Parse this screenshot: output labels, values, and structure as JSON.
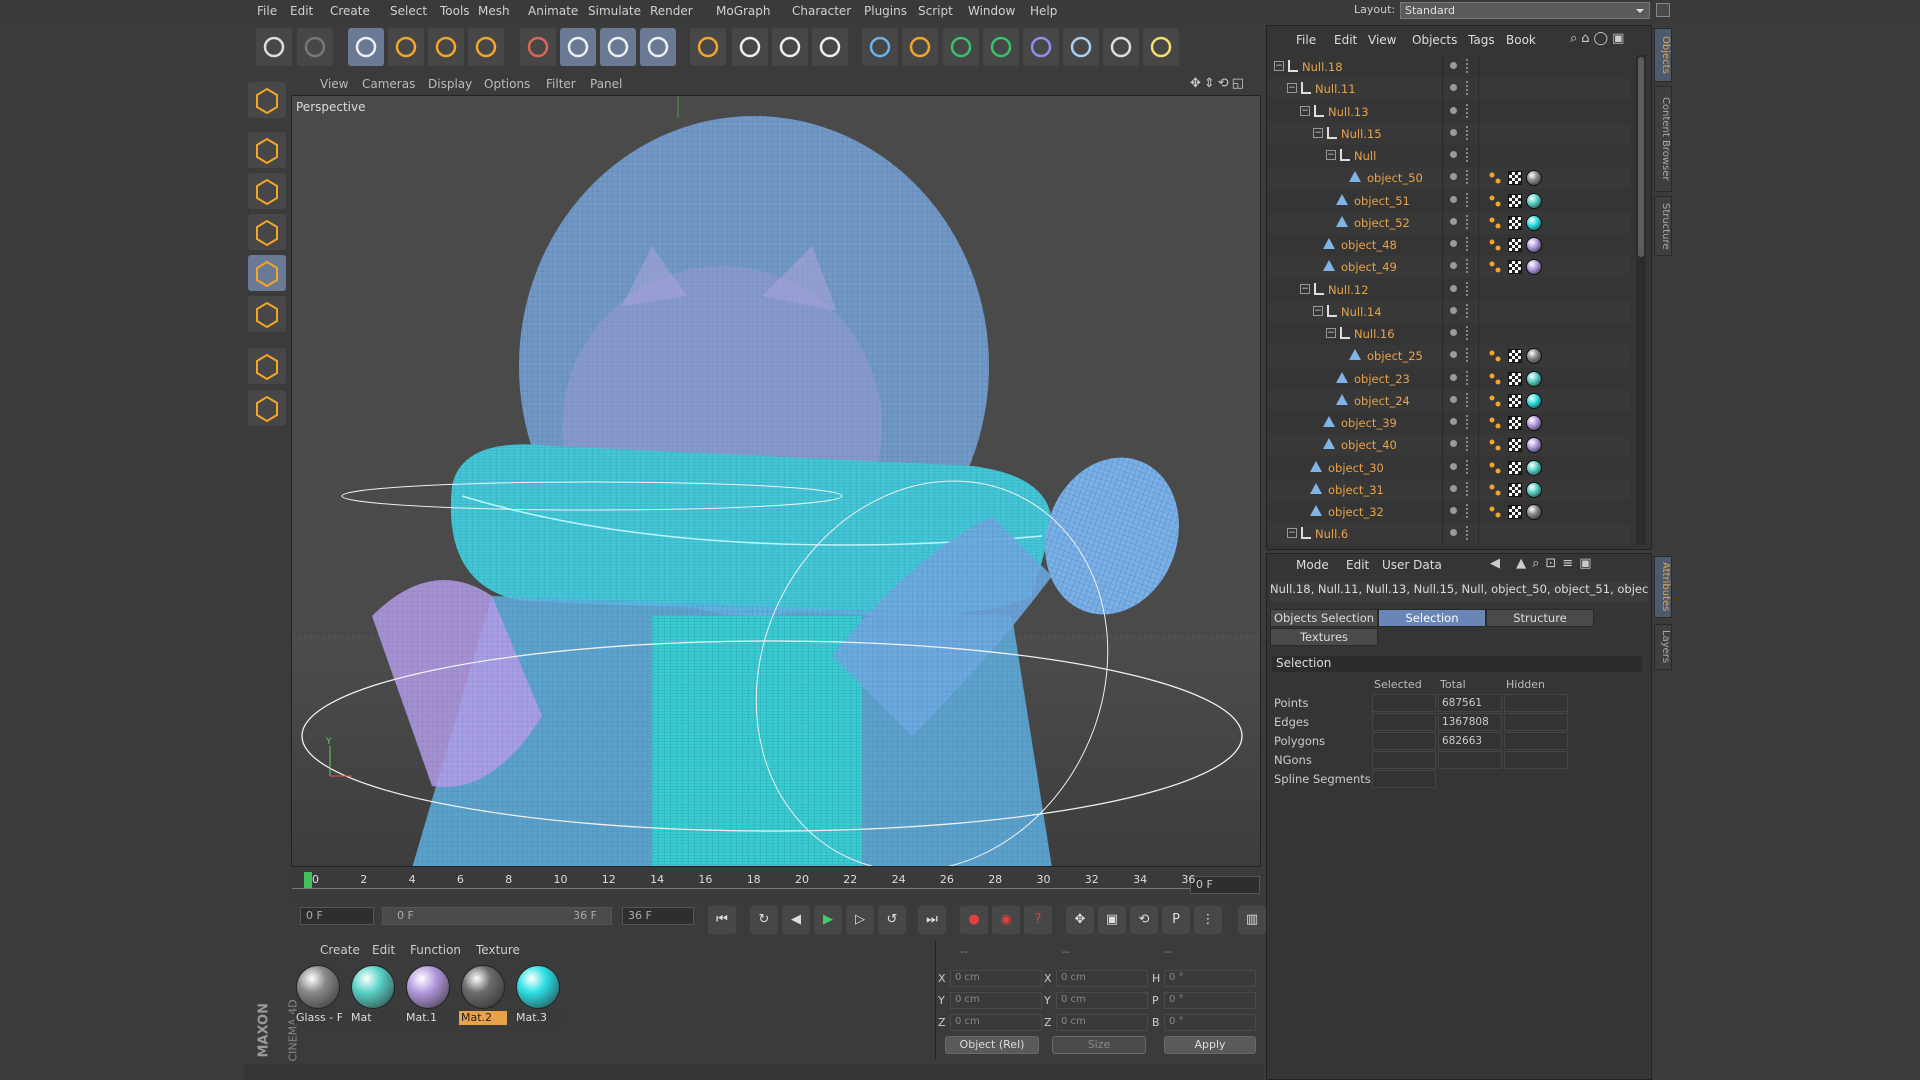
{
  "menubar": {
    "items": [
      "File",
      "Edit",
      "Create",
      "Select",
      "Tools",
      "Mesh",
      "Animate",
      "Simulate",
      "Render",
      "MoGraph",
      "Character",
      "Plugins",
      "Script",
      "Window",
      "Help"
    ],
    "layout_label": "Layout:",
    "layout_value": "Standard"
  },
  "viewport": {
    "menu": [
      "View",
      "Cameras",
      "Display",
      "Options",
      "Filter",
      "Panel"
    ],
    "label": "Perspective"
  },
  "timeline": {
    "ticks": [
      "0",
      "2",
      "4",
      "6",
      "8",
      "10",
      "12",
      "14",
      "16",
      "18",
      "20",
      "22",
      "24",
      "26",
      "28",
      "30",
      "32",
      "34",
      "36"
    ],
    "current_frame": "0 F",
    "start_field": "0 F",
    "range_start": "0 F",
    "range_end": "36 F",
    "end_field": "36 F"
  },
  "materials": {
    "menu": [
      "Create",
      "Edit",
      "Function",
      "Texture"
    ],
    "items": [
      {
        "label": "Glass - F",
        "color": "#8a8a8a"
      },
      {
        "label": "Mat",
        "color": "#5ad3c8"
      },
      {
        "label": "Mat.1",
        "color": "#b59be0"
      },
      {
        "label": "Mat.2",
        "color": "#6c6c6c",
        "active": true
      },
      {
        "label": "Mat.3",
        "color": "#2ee0e6"
      }
    ],
    "brand": "MAXON",
    "product": "CINEMA 4D"
  },
  "coords": {
    "header": [
      "--",
      "--",
      "--"
    ],
    "rows": [
      {
        "a": "X",
        "av": "0 cm",
        "b": "X",
        "bv": "0 cm",
        "c": "H",
        "cv": "0 °"
      },
      {
        "a": "Y",
        "av": "0 cm",
        "b": "Y",
        "bv": "0 cm",
        "c": "P",
        "cv": "0 °"
      },
      {
        "a": "Z",
        "av": "0 cm",
        "b": "Z",
        "bv": "0 cm",
        "c": "B",
        "cv": "0 °"
      }
    ],
    "mode": "Object (Rel)",
    "size": "Size",
    "apply": "Apply"
  },
  "object_manager": {
    "menu": [
      "File",
      "Edit",
      "View",
      "Objects",
      "Tags",
      "Book"
    ],
    "objects": [
      {
        "name": "Null.18",
        "type": "null",
        "depth": 0,
        "tags": false
      },
      {
        "name": "Null.11",
        "type": "null",
        "depth": 1,
        "tags": false
      },
      {
        "name": "Null.13",
        "type": "null",
        "depth": 2,
        "tags": false
      },
      {
        "name": "Null.15",
        "type": "null",
        "depth": 3,
        "tags": false
      },
      {
        "name": "Null",
        "type": "null",
        "depth": 4,
        "tags": false
      },
      {
        "name": "object_50",
        "type": "poly",
        "depth": 5,
        "tags": true,
        "mat": "#8a8a8a"
      },
      {
        "name": "object_51",
        "type": "poly",
        "depth": 4,
        "tags": true,
        "mat": "#5ad3c8"
      },
      {
        "name": "object_52",
        "type": "poly",
        "depth": 4,
        "tags": true,
        "mat": "#2ee0e6"
      },
      {
        "name": "object_48",
        "type": "poly",
        "depth": 3,
        "tags": true,
        "mat": "#b59be0"
      },
      {
        "name": "object_49",
        "type": "poly",
        "depth": 3,
        "tags": true,
        "mat": "#b59be0"
      },
      {
        "name": "Null.12",
        "type": "null",
        "depth": 2,
        "tags": false
      },
      {
        "name": "Null.14",
        "type": "null",
        "depth": 3,
        "tags": false
      },
      {
        "name": "Null.16",
        "type": "null",
        "depth": 4,
        "tags": false
      },
      {
        "name": "object_25",
        "type": "poly",
        "depth": 5,
        "tags": true,
        "mat": "#8a8a8a"
      },
      {
        "name": "object_23",
        "type": "poly",
        "depth": 4,
        "tags": true,
        "mat": "#5ad3c8"
      },
      {
        "name": "object_24",
        "type": "poly",
        "depth": 4,
        "tags": true,
        "mat": "#2ee0e6"
      },
      {
        "name": "object_39",
        "type": "poly",
        "depth": 3,
        "tags": true,
        "mat": "#b59be0"
      },
      {
        "name": "object_40",
        "type": "poly",
        "depth": 3,
        "tags": true,
        "mat": "#b59be0"
      },
      {
        "name": "object_30",
        "type": "poly",
        "depth": 2,
        "tags": true,
        "mat": "#5ad3c8"
      },
      {
        "name": "object_31",
        "type": "poly",
        "depth": 2,
        "tags": true,
        "mat": "#5ad3c8"
      },
      {
        "name": "object_32",
        "type": "poly",
        "depth": 2,
        "tags": true,
        "mat": "#8a8a8a"
      },
      {
        "name": "Null.6",
        "type": "null",
        "depth": 1,
        "tags": false
      }
    ],
    "side_tabs": [
      "Objects",
      "Content Browser",
      "Structure"
    ]
  },
  "attributes": {
    "menu": [
      "Mode",
      "Edit",
      "User Data"
    ],
    "path": "Null.18, Null.11, Null.13, Null.15, Null, object_50, object_51, objec",
    "tabs": [
      "Objects Selection",
      "Selection",
      "Structure",
      "Textures"
    ],
    "section": "Selection",
    "columns": [
      "Selected",
      "Total",
      "Hidden"
    ],
    "rows": [
      {
        "label": "Points",
        "total": "687561"
      },
      {
        "label": "Edges",
        "total": "1367808"
      },
      {
        "label": "Polygons",
        "total": "682663"
      },
      {
        "label": "NGons",
        "total": ""
      },
      {
        "label": "Spline Segments",
        "total": ""
      }
    ],
    "side_tabs": [
      "Attributes",
      "Layers"
    ]
  },
  "colors": {
    "accent": "#e8a34a",
    "selection": "#6a86b6",
    "wire": "#5aa8e0",
    "cyan": "#2ee0e6"
  }
}
